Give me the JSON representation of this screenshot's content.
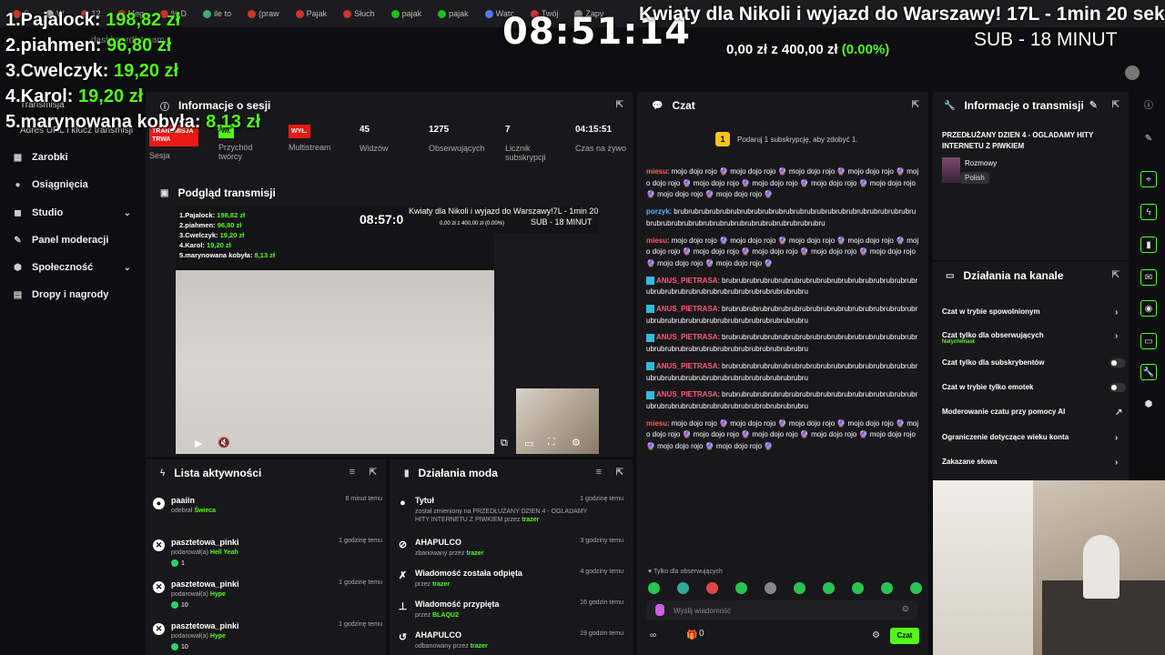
{
  "browser": {
    "tabs": [
      "S",
      "W",
      "12",
      "Meg",
      "% D",
      "ile to",
      "(praw",
      "Pajak",
      "Słuch",
      "pajak",
      "pajak",
      "Watc",
      "Twój",
      "Zapy"
    ],
    "address": "dashboard/stream"
  },
  "overlay": {
    "leaderboard": [
      {
        "rank_name": "1.Pajalock:",
        "amount": "198,82 zł"
      },
      {
        "rank_name": "2.piahmen:",
        "amount": "96,80 zł"
      },
      {
        "rank_name": "3.Cwelczyk:",
        "amount": "19,20 zł"
      },
      {
        "rank_name": "4.Karol:",
        "amount": "19,20 zł"
      },
      {
        "rank_name": "5.marynowana kobyła:",
        "amount": "8,13 zł"
      }
    ],
    "timer": "08:51:14",
    "goal_title": "Kwiaty dla Nikoli i wyjazd do Warszawy!",
    "goal_time": "17L - 1min 20 sek",
    "goal_sub": "SUB - 18 MINUT",
    "goal_amount": "0,00 zł z 400,00 zł",
    "goal_pct": "(0.00%)"
  },
  "sidebar": {
    "small_items": [
      "Transmisja",
      "Adres URL i klucz transmisji"
    ],
    "items": [
      {
        "label": "Zarobki",
        "icon": "earnings-icon"
      },
      {
        "label": "Osiągnięcia",
        "icon": "achievements-icon"
      },
      {
        "label": "Studio",
        "icon": "studio-icon"
      },
      {
        "label": "Panel moderacji",
        "icon": "moderation-icon"
      },
      {
        "label": "Społeczność",
        "icon": "community-icon"
      },
      {
        "label": "Dropy i nagrody",
        "icon": "drops-icon"
      }
    ]
  },
  "session": {
    "title": "Informacje o sesji",
    "stats": [
      {
        "value": "TRANSMISJA TRWA",
        "label": "Sesja"
      },
      {
        "value": "Wł.",
        "label": "Przychód twórcy"
      },
      {
        "value": "WYŁ.",
        "label": "Multistream"
      },
      {
        "value": "45",
        "label": "Widzów"
      },
      {
        "value": "1275",
        "label": "Obserwujących"
      },
      {
        "value": "7",
        "label": "Licznik subskrypcji"
      },
      {
        "value": "04:15:51",
        "label": "Czas na żywo"
      }
    ]
  },
  "preview": {
    "title": "Podgląd transmisji",
    "mini_leaderboard": [
      {
        "rank_name": "1.Pajalock:",
        "amount": "198,82 zł"
      },
      {
        "rank_name": "2.piahmen:",
        "amount": "96,80 zł"
      },
      {
        "rank_name": "3.Cwelczyk:",
        "amount": "19,20 zł"
      },
      {
        "rank_name": "4.Karol:",
        "amount": "19,20 zł"
      },
      {
        "rank_name": "5.marynowana kobyła:",
        "amount": "8,13 zł"
      }
    ],
    "mini_timer": "08:57:0",
    "mini_goal": "Kwiaty dla Nikoli i wyjazd do Warszawy!7L - 1min 20 sek",
    "mini_sub": "SUB - 18 MINUT",
    "mini_amount": "0,00 zł z 400,00 zł (0.00%)"
  },
  "activity": {
    "title": "Lista aktywności",
    "rows": [
      {
        "name": "paaiin",
        "desc": "odebrał",
        "item": "Świeca",
        "time": "8 minut temu",
        "gems": ""
      },
      {
        "name": "pasztetowa_pinki",
        "desc": "podarował(a)",
        "item": "Hell Yeah",
        "time": "1 godzinę temu",
        "gems": "1"
      },
      {
        "name": "pasztetowa_pinki",
        "desc": "podarował(a)",
        "item": "Hype",
        "time": "1 godzinę temu",
        "gems": "10"
      },
      {
        "name": "pasztetowa_pinki",
        "desc": "podarował(a)",
        "item": "Hype",
        "time": "1 godzinę temu",
        "gems": "10"
      }
    ]
  },
  "mod_actions": {
    "title": "Działania moda",
    "rows": [
      {
        "name": "Tytuł",
        "desc": "został zmieniony na PRZEDŁUŻANY DZIEN 4 - OGLADAMY HITY INTERNETU Z PIWKIEM przez",
        "by": "trazer",
        "time": "1 godzinę temu"
      },
      {
        "name": "AHAPULCO",
        "desc": "zbanowany przez",
        "by": "trazer",
        "time": "3 godziny temu"
      },
      {
        "name": "Wiadomość została odpięta",
        "desc": "przez",
        "by": "trazer",
        "time": "4 godziny temu"
      },
      {
        "name": "Wiadomość przypięta",
        "desc": "przez",
        "by": "BLAQU2",
        "time": "16 godzin temu"
      },
      {
        "name": "AHAPULCO",
        "desc": "odbanowany przez",
        "by": "trazer",
        "time": "19 godzin temu"
      }
    ]
  },
  "chat": {
    "title": "Czat",
    "promo": "Podaruj 1 subskrypcję, aby zdobyć 1.",
    "messages": [
      {
        "user": "miesu",
        "color": "red",
        "text": "mojo dojo rojo 🔮 mojo dojo rojo 🔮 mojo dojo rojo 🔮 mojo dojo rojo 🔮 mojo dojo rojo 🔮 mojo dojo rojo 🔮 mojo dojo rojo 🔮 mojo dojo rojo 🔮 mojo dojo rojo 🔮 mojo dojo rojo 🔮 mojo dojo rojo 🔮"
      },
      {
        "user": "porzyk",
        "color": "blue",
        "text": "brubrubrubrubrubrubrubrubrubrubrubrubrubrubrubrubrubrubrubrubrubrubrubrubrubrubrubrubrubrubrubrubrubrubrubrubrubrubrubru"
      },
      {
        "user": "miesu",
        "color": "red",
        "text": "mojo dojo rojo 🔮 mojo dojo rojo 🔮 mojo dojo rojo 🔮 mojo dojo rojo 🔮 mojo dojo rojo 🔮 mojo dojo rojo 🔮 mojo dojo rojo 🔮 mojo dojo rojo 🔮 mojo dojo rojo 🔮 mojo dojo rojo 🔮 mojo dojo rojo 🔮"
      },
      {
        "user": "ANUS_PIETRASA",
        "color": "pink",
        "text": "brubrubrubrubrubrubrubrubrubrubrubrubrubrubrubrubrubrubrubrubrubrubrubrubrubrubrubrubrubrubrubrubrubru"
      },
      {
        "user": "ANUS_PIETRASA",
        "color": "pink",
        "text": "brubrubrubrubrubrubrubrubrubrubrubrubrubrubrubrubrubrubrubrubrubrubrubrubrubrubrubrubrubrubrubrubrubru"
      },
      {
        "user": "ANUS_PIETRASA",
        "color": "pink",
        "text": "brubrubrubrubrubrubrubrubrubrubrubrubrubrubrubrubrubrubrubrubrubrubrubrubrubrubrubrubrubrubrubrubrubru"
      },
      {
        "user": "ANUS_PIETRASA",
        "color": "pink",
        "text": "brubrubrubrubrubrubrubrubrubrubrubrubrubrubrubrubrubrubrubrubrubrubrubrubrubrubrubrubrubrubrubrubrubru"
      },
      {
        "user": "ANUS_PIETRASA",
        "color": "pink",
        "text": "brubrubrubrubrubrubrubrubrubrubrubrubrubrubrubrubrubrubrubrubrubrubrubrubrubrubrubrubrubrubrubrubrubru"
      },
      {
        "user": "miesu",
        "color": "red",
        "text": "mojo dojo rojo 🔮 mojo dojo rojo 🔮 mojo dojo rojo 🔮 mojo dojo rojo 🔮 mojo dojo rojo 🔮 mojo dojo rojo 🔮 mojo dojo rojo 🔮 mojo dojo rojo 🔮 mojo dojo rojo 🔮 mojo dojo rojo 🔮 mojo dojo rojo 🔮"
      }
    ],
    "followers_only": "Tylko dla obserwujących",
    "input_placeholder": "Wyślij wiadomość",
    "send_label": "Czat",
    "points": "0"
  },
  "stream_info": {
    "title": "Informacje o transmisji",
    "stream_title": "PRZEDŁUŻANY DZIEN 4 - OGLADAMY HITY INTERNETU Z PIWKIEM",
    "category": "Rozmowy",
    "language": "Polish"
  },
  "channel_actions": {
    "title": "Działania na kanale",
    "rows": [
      {
        "label": "Czat w trybie spowolnionym",
        "sub": "",
        "control": "chevron"
      },
      {
        "label": "Czat tylko dla obserwujących",
        "sub": "Natychmiast",
        "control": "chevron"
      },
      {
        "label": "Czat tylko dla subskrybentów",
        "sub": "",
        "control": "toggle"
      },
      {
        "label": "Czat w trybie tylko emotek",
        "sub": "",
        "control": "toggle"
      },
      {
        "label": "Moderowanie czatu przy pomocy AI",
        "sub": "",
        "control": "external"
      },
      {
        "label": "Ograniczenie dotyczące wieku konta",
        "sub": "",
        "control": "chevron"
      },
      {
        "label": "Zakazane słowa",
        "sub": "",
        "control": "chevron"
      }
    ]
  },
  "colors": {
    "accent": "#53fc18",
    "panel": "#18181b",
    "background": "#0e0e10",
    "live_red": "#e91916"
  }
}
